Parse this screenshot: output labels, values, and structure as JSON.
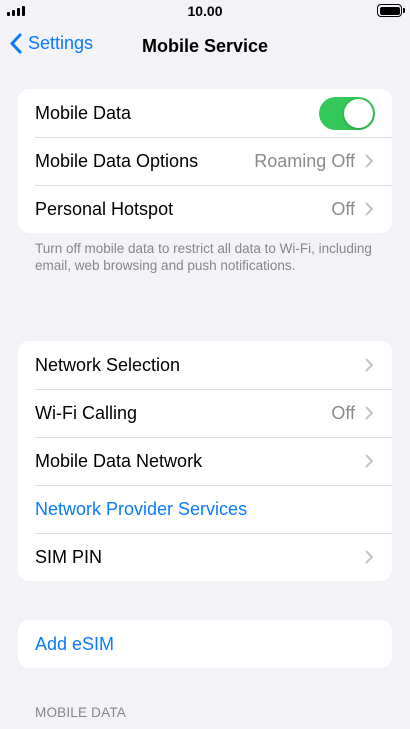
{
  "status_bar": {
    "time": "10.00"
  },
  "nav": {
    "back_label": "Settings",
    "title": "Mobile Service"
  },
  "group1": {
    "mobile_data": {
      "label": "Mobile Data",
      "enabled": true
    },
    "mobile_data_options": {
      "label": "Mobile Data Options",
      "value": "Roaming Off"
    },
    "personal_hotspot": {
      "label": "Personal Hotspot",
      "value": "Off"
    }
  },
  "group1_footer": "Turn off mobile data to restrict all data to Wi-Fi, including email, web browsing and push notifications.",
  "group2": {
    "network_selection": {
      "label": "Network Selection"
    },
    "wifi_calling": {
      "label": "Wi-Fi Calling",
      "value": "Off"
    },
    "mobile_data_network": {
      "label": "Mobile Data Network"
    },
    "network_provider_services": {
      "label": "Network Provider Services"
    },
    "sim_pin": {
      "label": "SIM PIN"
    }
  },
  "group3": {
    "add_esim": {
      "label": "Add eSIM"
    }
  },
  "section_mobile_data_header": "MOBILE DATA",
  "colors": {
    "accent": "#0a7aff",
    "toggle_on": "#34c759",
    "background": "#f2f2f7"
  },
  "icons": {
    "back": "chevron-left-icon",
    "disclosure": "chevron-right-icon"
  }
}
